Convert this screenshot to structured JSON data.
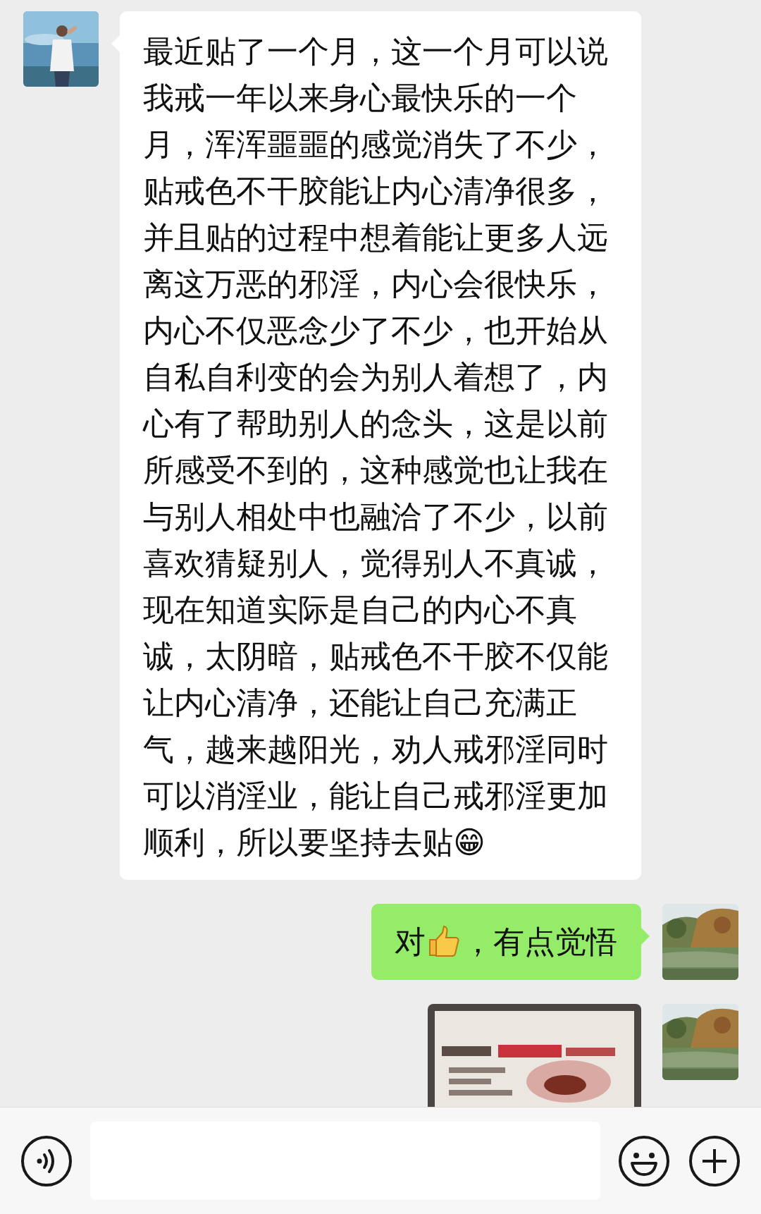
{
  "messages": [
    {
      "outgoing": false,
      "kind": "text",
      "parts": [
        {
          "kind": "text",
          "text": "最近贴了一个月，这一个月可以说我戒一年以来身心最快乐的一个月，浑浑噩噩的感觉消失了不少，贴戒色不干胶能让内心清净很多，并且贴的过程中想着能让更多人远离这万恶的邪淫，内心会很快乐，内心不仅恶念少了不少，也开始从自私自利变的会为别人着想了，内心有了帮助别人的念头，这是以前所感受不到的，这种感觉也让我在与别人相处中也融洽了不少，以前喜欢猜疑别人，觉得别人不真诚，现在知道实际是自己的内心不真诚，太阴暗，贴戒色不干胶不仅能让内心清净，还能让自己充满正气，越来越阳光，劝人戒邪淫同时可以消淫业，能让自己戒邪淫更加顺利，所以要坚持去贴😁"
        }
      ]
    },
    {
      "outgoing": true,
      "kind": "text",
      "parts": [
        {
          "kind": "text",
          "text": "对"
        },
        {
          "kind": "thumbs"
        },
        {
          "kind": "text",
          "text": "，有点觉悟"
        }
      ]
    },
    {
      "outgoing": true,
      "kind": "picture"
    }
  ]
}
